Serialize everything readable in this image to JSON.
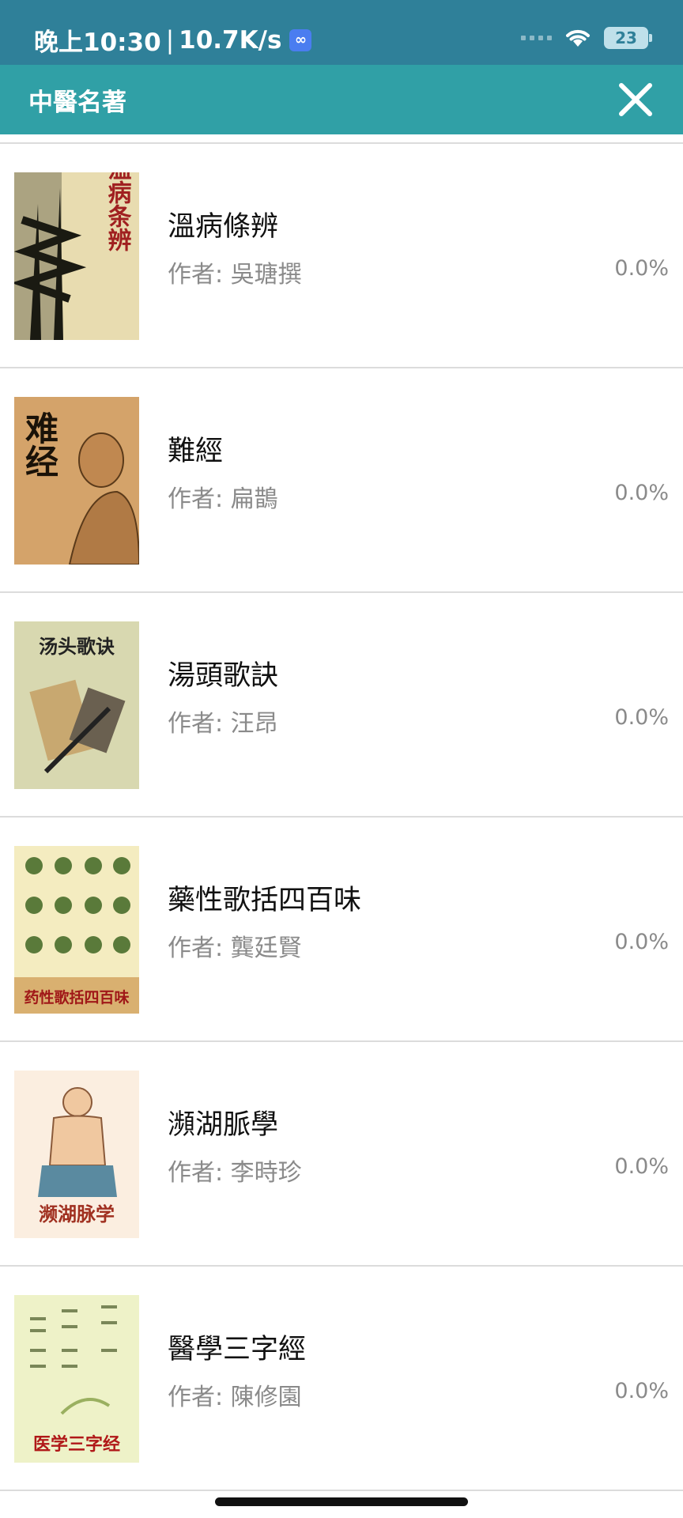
{
  "status_bar": {
    "time": "晚上10:30",
    "separator": "|",
    "net_speed": "10.7K/s",
    "battery": "23",
    "icons": [
      "network-badge-icon",
      "signal-icon",
      "wifi-icon",
      "battery-icon"
    ]
  },
  "app_bar": {
    "title": "中醫名著",
    "close_icon": "close-icon",
    "background": "#30a0a6"
  },
  "books": [
    {
      "title": "溫病條辨",
      "author": "作者: 吳瑭撰",
      "progress": "0.0%",
      "cover_text": "温病条辨"
    },
    {
      "title": "難經",
      "author": "作者: 扁鵲",
      "progress": "0.0%",
      "cover_text": "难经"
    },
    {
      "title": "湯頭歌訣",
      "author": "作者: 汪昂",
      "progress": "0.0%",
      "cover_text": "汤头歌诀"
    },
    {
      "title": "藥性歌括四百味",
      "author": "作者: 龔廷賢",
      "progress": "0.0%",
      "cover_text": "药性歌括四百味"
    },
    {
      "title": "瀕湖脈學",
      "author": "作者: 李時珍",
      "progress": "0.0%",
      "cover_text": "濒湖脉学"
    },
    {
      "title": "醫學三字經",
      "author": "作者: 陳修園",
      "progress": "0.0%",
      "cover_text": "医学三字经"
    }
  ]
}
